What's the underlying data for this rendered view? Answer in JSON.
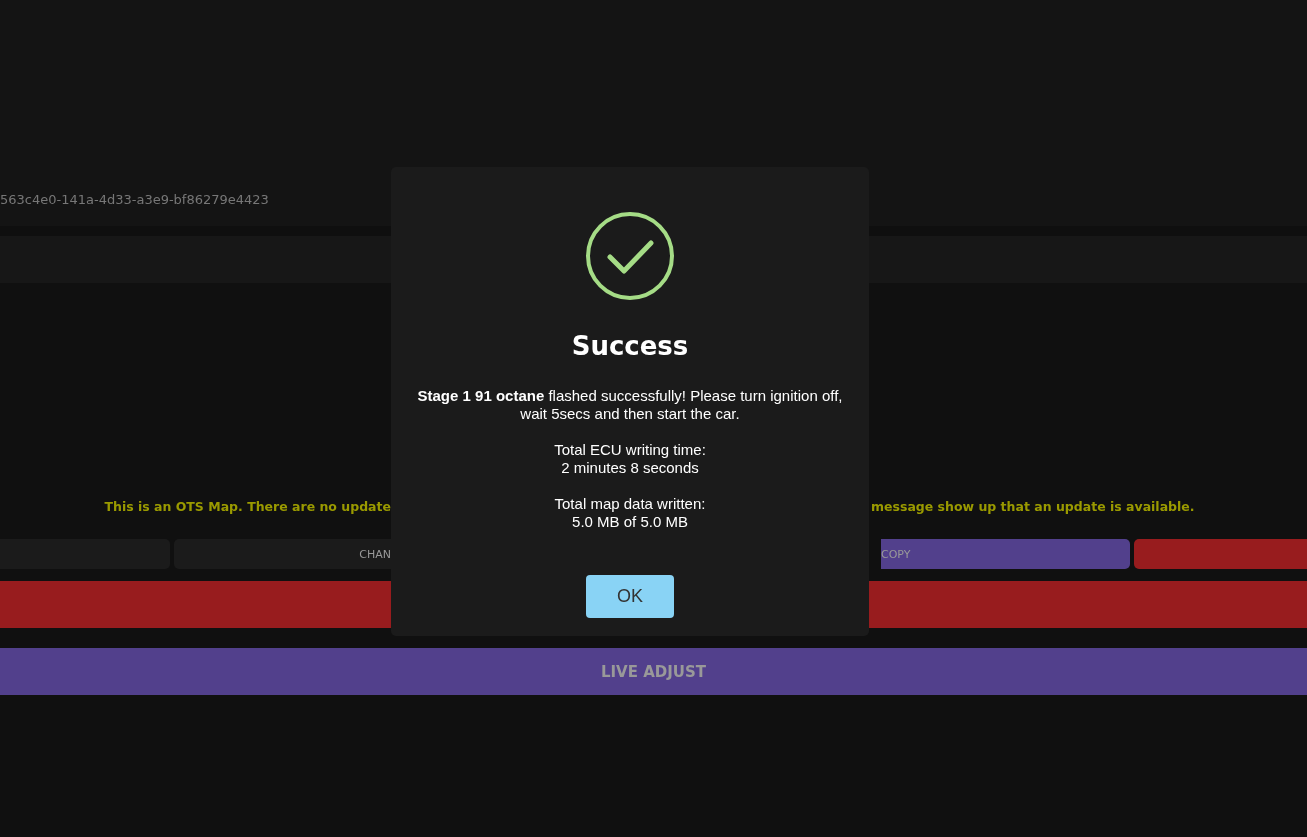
{
  "page": {
    "device_id": "563c4e0-141a-4d33-a3e9-bf86279e4423",
    "notice": {
      "left": "This is an OTS Map. There are no update",
      "right": "message show up that an update is available."
    },
    "buttons": [
      {
        "kind": "plain"
      },
      {
        "kind": "plain",
        "label": "CHAN"
      },
      {
        "kind": "purple",
        "label": "COPY"
      },
      {
        "kind": "red"
      }
    ],
    "bars": [
      {
        "kind": "red"
      },
      {
        "kind": "purple",
        "label": "LIVE ADJUST"
      }
    ]
  },
  "dialog": {
    "title": "Success",
    "message": "**Stage 1 91 octane** flashed successfully! Please turn ignition off, wait 5secs and then start the car.",
    "stats": [
      {
        "label": "Total ECU writing time:",
        "value": "2 minutes 8 seconds"
      },
      {
        "label": "Total map data written:",
        "value": "5.0 MB of 5.0 MB"
      }
    ],
    "button": "OK"
  }
}
